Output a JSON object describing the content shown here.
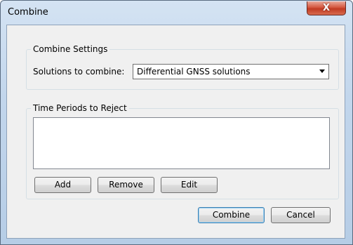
{
  "window": {
    "title": "Combine",
    "close_icon_glyph": "X"
  },
  "settings_group": {
    "title": "Combine Settings",
    "solutions_label": "Solutions to combine:",
    "solutions_selected": "Differential GNSS solutions"
  },
  "reject_group": {
    "title": "Time Periods to Reject",
    "items": [],
    "add_label": "Add",
    "remove_label": "Remove",
    "edit_label": "Edit"
  },
  "footer": {
    "combine_label": "Combine",
    "cancel_label": "Cancel"
  },
  "icons": {
    "close": "close-icon",
    "dropdown": "chevron-down-icon"
  },
  "colors": {
    "close_button": "#c9452c",
    "frame": "#c2d6ec",
    "client": "#f0f0f0"
  }
}
